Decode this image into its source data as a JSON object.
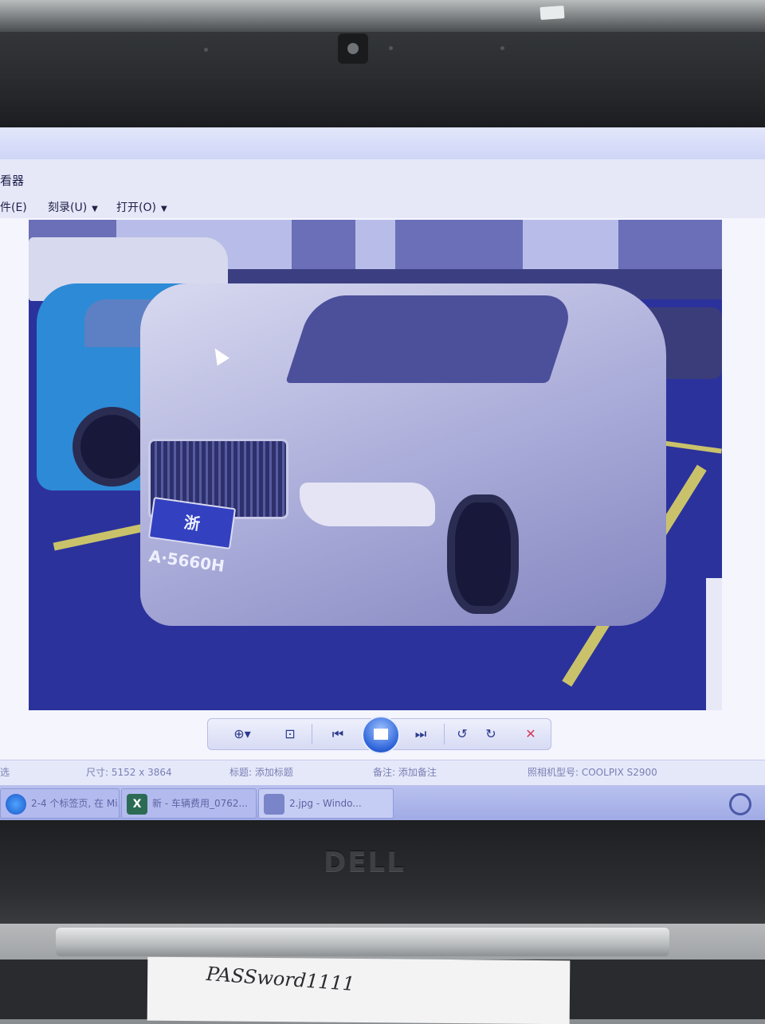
{
  "window": {
    "title": "看器"
  },
  "menu": [
    {
      "label": "件(E)"
    },
    {
      "label": "刻录(U)"
    },
    {
      "label": "打开(O)"
    }
  ],
  "photo": {
    "plate_text": "浙A·5660H"
  },
  "toolbar": {
    "zoom_icon": "zoom-icon",
    "fit_icon": "fit-to-window-icon",
    "prev_icon": "previous-icon",
    "slideshow_icon": "slideshow-icon",
    "next_icon": "next-icon",
    "rotate_ccw_icon": "rotate-counterclockwise-icon",
    "rotate_cw_icon": "rotate-clockwise-icon",
    "delete_icon": "delete-icon"
  },
  "status": {
    "left": "选",
    "dimensions": "尺寸: 5152 x 3864",
    "title": "标题: 添加标题",
    "notes": "备注: 添加备注",
    "camera": "照相机型号: COOLPIX S2900"
  },
  "taskbar": {
    "items": [
      {
        "label": "2-4 个标签页, 在 Mi..."
      },
      {
        "label": "新 - 车辆费用_0762..."
      },
      {
        "label": "2.jpg - Windo..."
      }
    ]
  },
  "laptop": {
    "brand": "DELL"
  },
  "note": {
    "text": "PASSword1111"
  },
  "colors": {
    "screen_tint": "#e6e8f8",
    "accent": "#2c63d8"
  }
}
